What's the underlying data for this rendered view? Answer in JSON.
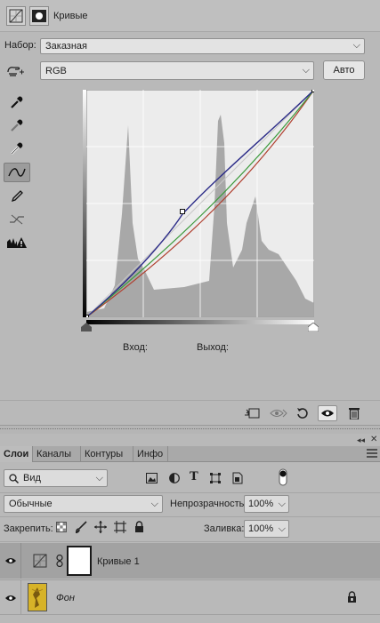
{
  "properties": {
    "title": "Кривые",
    "preset_label": "Набор:",
    "preset_value": "Заказная",
    "channel_value": "RGB",
    "auto_label": "Авто",
    "input_label": "Вход:",
    "output_label": "Выход:"
  },
  "layers_panel": {
    "tabs": [
      "Слои",
      "Каналы",
      "Контуры",
      "Инфо"
    ],
    "filter_value": "Вид",
    "blend_mode": "Обычные",
    "opacity_label": "Непрозрачность:",
    "opacity_value": "100%",
    "lock_label": "Закрепить:",
    "fill_label": "Заливка:",
    "fill_value": "100%",
    "layers": [
      {
        "name": "Кривые 1",
        "type": "adjustment",
        "selected": true
      },
      {
        "name": "Фон",
        "type": "image",
        "locked": true
      }
    ]
  },
  "colors": {
    "rgb_curve": "#2c2c88",
    "green_curve": "#3c9a3c",
    "red_curve": "#b04030",
    "histogram": "#a4a4a4",
    "graph_bg": "#ececec"
  }
}
